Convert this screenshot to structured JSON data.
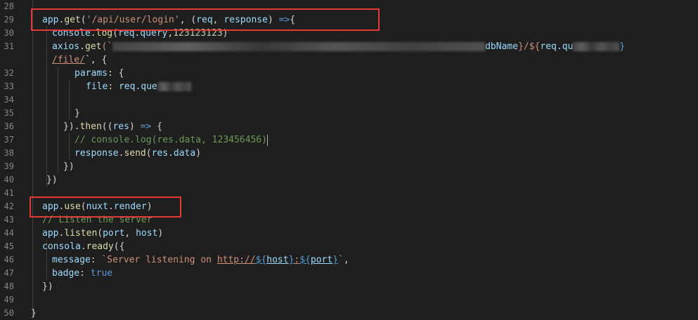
{
  "editor": {
    "line_numbers": [
      "28",
      "29",
      "30",
      "31",
      "",
      "32",
      "33",
      "34",
      "35",
      "36",
      "37",
      "38",
      "39",
      "40",
      "41",
      "42",
      "43",
      "44",
      "45",
      "46",
      "47",
      "48",
      "49",
      "50"
    ],
    "lines": {
      "l29": {
        "a": "app",
        "b": ".",
        "c": "get",
        "d": "(",
        "e": "'/api/user/login'",
        "f": ", (",
        "g": "req",
        "h": ", ",
        "i": "response",
        "j": ") ",
        "k": "=>",
        "l": "{"
      },
      "l30": {
        "a": "console",
        "b": ".",
        "c": "log",
        "d": "(",
        "e": "req",
        "f": ".",
        "g": "query",
        "h": ",",
        "i": "123123123",
        "j": ")"
      },
      "l31": {
        "a": "axios",
        "b": ".",
        "c": "get",
        "d": "(`",
        "e": "dbName",
        "f": "}/${",
        "g": "req.qu",
        "h": "}"
      },
      "l31b": {
        "a": "/file/",
        "b": "`, {"
      },
      "l32": {
        "a": "params",
        "b": ": {"
      },
      "l33": {
        "a": "file",
        "b": ": ",
        "c": "req",
        "d": ".",
        "e": "que"
      },
      "l35": {
        "a": "}"
      },
      "l36": {
        "a": "}).",
        "b": "then",
        "c": "((",
        "d": "res",
        "e": ") ",
        "f": "=>",
        "g": " {"
      },
      "l37": {
        "a": "// console.log(res.data, 123456456)"
      },
      "l38": {
        "a": "response",
        "b": ".",
        "c": "send",
        "d": "(",
        "e": "res",
        "f": ".",
        "g": "data",
        "h": ")"
      },
      "l39": {
        "a": "})"
      },
      "l40": {
        "a": "})"
      },
      "l42": {
        "a": "app",
        "b": ".",
        "c": "use",
        "d": "(",
        "e": "nuxt",
        "f": ".",
        "g": "render",
        "h": ")"
      },
      "l43": {
        "a": "// Listen the server"
      },
      "l44": {
        "a": "app",
        "b": ".",
        "c": "listen",
        "d": "(",
        "e": "port",
        "f": ", ",
        "g": "host",
        "h": ")"
      },
      "l45": {
        "a": "consola",
        "b": ".",
        "c": "ready",
        "d": "({"
      },
      "l46": {
        "a": "message",
        "b": ": ",
        "c": "`Server listening on ",
        "d": "http://",
        "e": "${",
        "f": "host",
        "g": "}",
        "h": ":",
        "i": "${",
        "j": "port",
        "k": "}",
        "l": "`",
        "m": ","
      },
      "l47": {
        "a": "badge",
        "b": ": ",
        "c": "true"
      },
      "l48": {
        "a": "})"
      },
      "l50": {
        "a": "}"
      }
    }
  },
  "colors": {
    "background": "#1e1e1e",
    "highlight_box": "#e53935",
    "function": "#dcdcaa",
    "variable": "#9cdcfe",
    "string": "#ce9178",
    "number": "#b5cea8",
    "keyword": "#569cd6",
    "comment": "#6a9955"
  }
}
